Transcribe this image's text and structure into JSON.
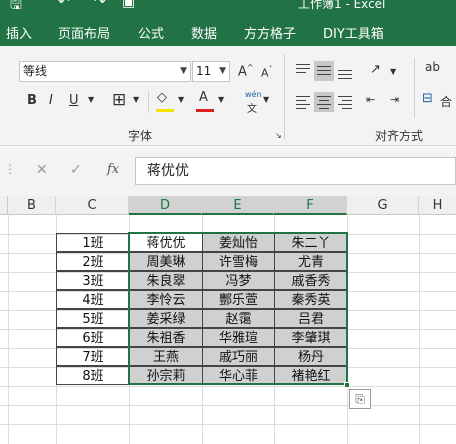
{
  "titlebar": {
    "title": "工作簿1 - Excel"
  },
  "tabs": [
    "插入",
    "页面布局",
    "公式",
    "数据",
    "方方格子",
    "DIY工具箱"
  ],
  "font": {
    "name": "等线",
    "size": "11"
  },
  "ribbon": {
    "bold": "B",
    "italic": "I",
    "underline": "U",
    "group_font": "字体",
    "group_align": "对齐方式",
    "wen": "wén",
    "ab": "ab",
    "he": "合"
  },
  "formula_bar": {
    "fx": "fx",
    "cancel": "✕",
    "enter": "✓",
    "value": "蒋优优"
  },
  "columns": [
    "B",
    "C",
    "D",
    "E",
    "F",
    "G",
    "H"
  ],
  "classes": [
    "1班",
    "2班",
    "3班",
    "4班",
    "5班",
    "6班",
    "7班",
    "8班"
  ],
  "names": [
    [
      "蒋优优",
      "姜灿怡",
      "朱二丫"
    ],
    [
      "周美琳",
      "许雪梅",
      "尤青"
    ],
    [
      "朱良翠",
      "冯梦",
      "戚香秀"
    ],
    [
      "李怜云",
      "酆乐萱",
      "秦秀英"
    ],
    [
      "姜采绿",
      "赵霭",
      "吕君"
    ],
    [
      "朱祖香",
      "华雅瑄",
      "李肇琪"
    ],
    [
      "王燕",
      "戚巧丽",
      "杨丹"
    ],
    [
      "孙宗莉",
      "华心菲",
      "褚艳红"
    ]
  ],
  "colors": {
    "accent": "#217346",
    "selection_fill": "#d0d0d0",
    "font_color": "#e02020",
    "highlight": "#f5e400"
  }
}
